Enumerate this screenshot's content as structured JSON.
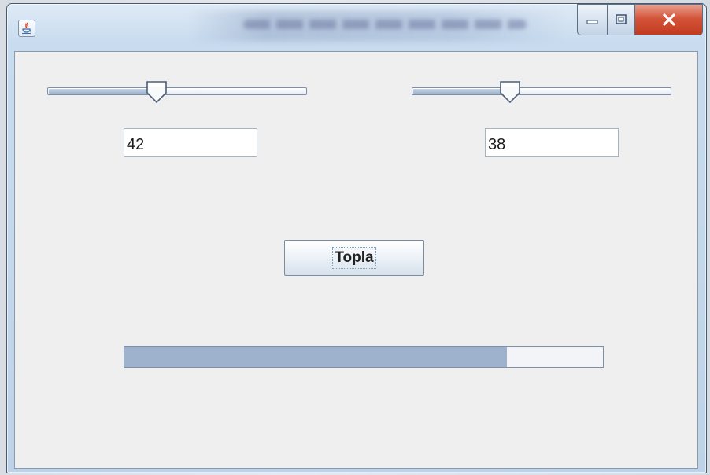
{
  "window": {
    "app_icon": "java-icon",
    "controls": {
      "minimize_icon": "minimize-icon",
      "maximize_icon": "maximize-icon",
      "close_icon": "close-icon"
    }
  },
  "left": {
    "slider_value": 42,
    "field_value": "42"
  },
  "right": {
    "slider_value": 38,
    "field_value": "38"
  },
  "button": {
    "label": "Topla"
  },
  "progress": {
    "value": 80
  },
  "colors": {
    "client_bg": "#efefef",
    "progress_fill": "#9fb2cd",
    "close_red": "#c23a1f"
  }
}
